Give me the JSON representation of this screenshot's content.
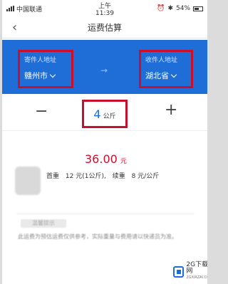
{
  "status_bar": {
    "carrier": "中国联通",
    "time": "上午11:39",
    "battery": "54%"
  },
  "nav": {
    "back_icon": "chevron-left-icon",
    "title": "运费估算"
  },
  "sender": {
    "label": "寄件人地址",
    "value": "赣州市"
  },
  "receiver": {
    "label": "收件人地址",
    "value": "湖北省"
  },
  "arrow_icon": "arrow-right-icon",
  "weight": {
    "minus": "−",
    "value": "4",
    "unit": "公斤",
    "plus": "+"
  },
  "price": {
    "amount": "36.00",
    "currency": "元"
  },
  "rates": {
    "first_label": "首重",
    "first_value": "12 元(1公斤),",
    "extra_label": "续重",
    "extra_value": "8 元/公斤"
  },
  "notes": {
    "tag": "温馨提示",
    "text": "此运费为预估运费仅供参考，实际重量与费用请以快递员为准。"
  },
  "watermark": {
    "brand": "2G下载网",
    "sub": "2GXIAZAI.COM"
  },
  "colors": {
    "primary_blue": "#1f6ed8",
    "highlight_red": "#c8102e"
  }
}
